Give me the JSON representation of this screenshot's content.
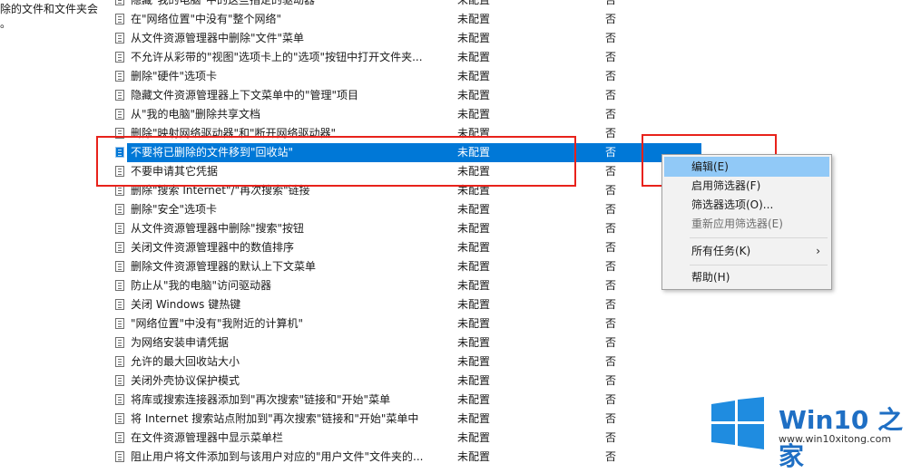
{
  "left_pane": {
    "line1": "除的文件和文件夹会",
    "line2": "。"
  },
  "rows": [
    {
      "name": "隐藏\"我的电脑\"中的这些指定的驱动器",
      "state": "未配置",
      "comment": "否"
    },
    {
      "name": "在\"网络位置\"中没有\"整个网络\"",
      "state": "未配置",
      "comment": "否"
    },
    {
      "name": "从文件资源管理器中删除\"文件\"菜单",
      "state": "未配置",
      "comment": "否"
    },
    {
      "name": "不允许从彩带的\"视图\"选项卡上的\"选项\"按钮中打开文件夹...",
      "state": "未配置",
      "comment": "否"
    },
    {
      "name": "删除\"硬件\"选项卡",
      "state": "未配置",
      "comment": "否"
    },
    {
      "name": "隐藏文件资源管理器上下文菜单中的\"管理\"项目",
      "state": "未配置",
      "comment": "否"
    },
    {
      "name": "从\"我的电脑\"删除共享文档",
      "state": "未配置",
      "comment": "否"
    },
    {
      "name": "删除\"映射网络驱动器\"和\"断开网络驱动器\"",
      "state": "未配置",
      "comment": "否"
    },
    {
      "name": "不要将已删除的文件移到\"回收站\"",
      "state": "未配置",
      "comment": "否",
      "selected": true
    },
    {
      "name": "不要申请其它凭据",
      "state": "未配置",
      "comment": "否"
    },
    {
      "name": "删除\"搜索 Internet\"/\"再次搜索\"链接",
      "state": "未配置",
      "comment": "否"
    },
    {
      "name": "删除\"安全\"选项卡",
      "state": "未配置",
      "comment": "否"
    },
    {
      "name": "从文件资源管理器中删除\"搜索\"按钮",
      "state": "未配置",
      "comment": "否"
    },
    {
      "name": "关闭文件资源管理器中的数值排序",
      "state": "未配置",
      "comment": "否"
    },
    {
      "name": "删除文件资源管理器的默认上下文菜单",
      "state": "未配置",
      "comment": "否"
    },
    {
      "name": "防止从\"我的电脑\"访问驱动器",
      "state": "未配置",
      "comment": "否"
    },
    {
      "name": "关闭 Windows 键热键",
      "state": "未配置",
      "comment": "否"
    },
    {
      "name": "\"网络位置\"中没有\"我附近的计算机\"",
      "state": "未配置",
      "comment": "否"
    },
    {
      "name": "为网络安装申请凭据",
      "state": "未配置",
      "comment": "否"
    },
    {
      "name": "允许的最大回收站大小",
      "state": "未配置",
      "comment": "否"
    },
    {
      "name": "关闭外壳协议保护模式",
      "state": "未配置",
      "comment": "否"
    },
    {
      "name": "将库或搜索连接器添加到\"再次搜索\"链接和\"开始\"菜单",
      "state": "未配置",
      "comment": "否"
    },
    {
      "name": "将 Internet 搜索站点附加到\"再次搜索\"链接和\"开始\"菜单中",
      "state": "未配置",
      "comment": "否"
    },
    {
      "name": "在文件资源管理器中显示菜单栏",
      "state": "未配置",
      "comment": "否"
    },
    {
      "name": "阻止用户将文件添加到与该用户对应的\"用户文件\"文件夹的...",
      "state": "未配置",
      "comment": "否"
    }
  ],
  "context_menu": {
    "edit": "编辑(E)",
    "enable_filter": "启用筛选器(F)",
    "filter_options": "筛选器选项(O)...",
    "reapply_filter": "重新应用筛选器(E)",
    "all_tasks": "所有任务(K)",
    "all_tasks_arrow": "›",
    "help": "帮助(H)"
  },
  "watermark": {
    "brand": "Win10 之家",
    "url": "www.win10xitong.com",
    "colors": {
      "blue": "#1f6fc4"
    }
  },
  "colors": {
    "selection": "#0078d7",
    "menu_highlight": "#91c9f7",
    "annotation_red": "#e8221b"
  }
}
